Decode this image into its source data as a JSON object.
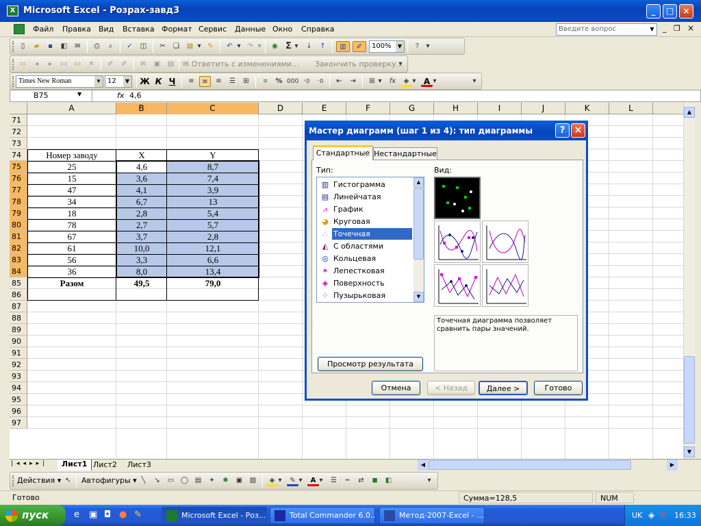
{
  "window": {
    "title": "Microsoft Excel - Розрах-завд3"
  },
  "menu": [
    "Файл",
    "Правка",
    "Вид",
    "Вставка",
    "Формат",
    "Сервис",
    "Данные",
    "Окно",
    "Справка"
  ],
  "ask_placeholder": "Введите вопрос",
  "toolbar": {
    "zoom": "100%"
  },
  "review_toolbar": {
    "reply": "Ответить с изменениями...",
    "end": "Закончить проверку..."
  },
  "format_toolbar": {
    "font": "Times New Roman",
    "size": "12",
    "bold": "Ж",
    "italic": "К",
    "underline": "Ч",
    "percent": "%",
    "thousands": "000"
  },
  "formula": {
    "cell_ref": "B75",
    "fx": "fx",
    "content": "4,6"
  },
  "columns": [
    "A",
    "B",
    "C",
    "D",
    "E",
    "F",
    "G",
    "H",
    "I",
    "J",
    "K",
    "L"
  ],
  "row_numbers": [
    "71",
    "72",
    "73",
    "74",
    "75",
    "76",
    "77",
    "78",
    "79",
    "80",
    "81",
    "82",
    "83",
    "84",
    "85",
    "86",
    "87",
    "88",
    "89",
    "90",
    "91",
    "92",
    "93",
    "94",
    "95",
    "96",
    "97"
  ],
  "table": {
    "headers": [
      "Номер заводу",
      "X",
      "Y"
    ],
    "rows": [
      [
        "25",
        "4,6",
        "8,7"
      ],
      [
        "15",
        "3,6",
        "7,4"
      ],
      [
        "47",
        "4,1",
        "3,9"
      ],
      [
        "34",
        "6,7",
        "13"
      ],
      [
        "18",
        "2,8",
        "5,4"
      ],
      [
        "78",
        "2,7",
        "5,7"
      ],
      [
        "67",
        "3,7",
        "2,8"
      ],
      [
        "61",
        "10,0",
        "12,1"
      ],
      [
        "56",
        "3,3",
        "6,6"
      ],
      [
        "36",
        "8,0",
        "13,4"
      ]
    ],
    "totals": [
      "Разом",
      "49,5",
      "79,0"
    ]
  },
  "dialog": {
    "title": "Мастер диаграмм (шаг 1 из 4): тип диаграммы",
    "tabs": [
      "Стандартные",
      "Нестандартные"
    ],
    "type_label": "Тип:",
    "view_label": "Вид:",
    "types": [
      "Гистограмма",
      "Линейчатая",
      "График",
      "Круговая",
      "Точечная",
      "С областями",
      "Кольцевая",
      "Лепестковая",
      "Поверхность",
      "Пузырьковая"
    ],
    "selected_type": "Точечная",
    "description": "Точечная диаграмма позволяет сравнить пары значений.",
    "preview_button": "Просмотр результата",
    "buttons": {
      "cancel": "Отмена",
      "back": "< Назад",
      "next": "Далее >",
      "finish": "Готово"
    }
  },
  "sheets": [
    "Лист1",
    "Лист2",
    "Лист3"
  ],
  "drawing": {
    "actions": "Действия",
    "autoshapes": "Автофигуры"
  },
  "status": {
    "ready": "Готово",
    "sum": "Сумма=128,5",
    "num": "NUM"
  },
  "taskbar": {
    "start": "пуск",
    "tasks": [
      "Microsoft Excel - Роз...",
      "Total Commander 6.0...",
      "Метод-2007-Excel - ..."
    ],
    "lang": "UK",
    "time": "16:33"
  }
}
